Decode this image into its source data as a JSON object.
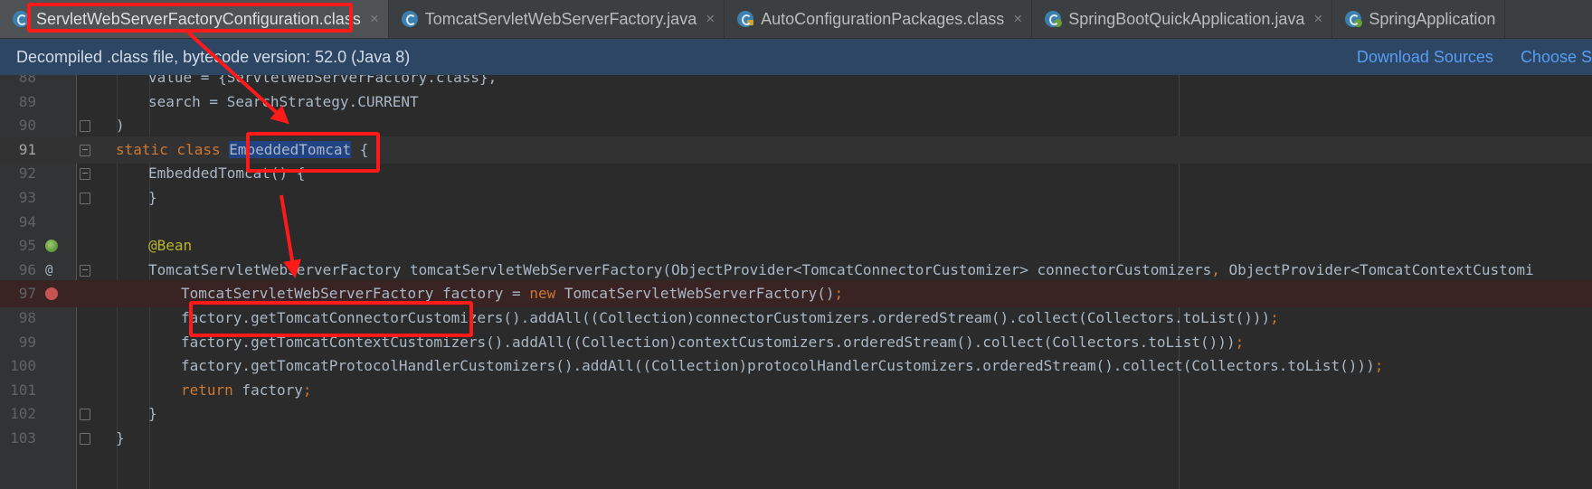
{
  "tabs": [
    {
      "label": "ServletWebServerFactoryConfiguration.class",
      "icon": "class-file-icon",
      "active": true
    },
    {
      "label": "TomcatServletWebServerFactory.java",
      "icon": "class-file-icon",
      "active": false
    },
    {
      "label": "AutoConfigurationPackages.class",
      "icon": "locked-class-file-icon",
      "active": false
    },
    {
      "label": "SpringBootQuickApplication.java",
      "icon": "spring-boot-class-icon",
      "active": false
    },
    {
      "label": "SpringApplication",
      "icon": "spring-boot-class-icon",
      "active": false
    }
  ],
  "tab_close_glyph": "×",
  "banner": {
    "message": "Decompiled .class file, bytecode version: 52.0 (Java 8)",
    "download_sources": "Download Sources",
    "choose_sources": "Choose S"
  },
  "code_lines": [
    {
      "n": "88",
      "indent": 2,
      "text": "value = {ServletWebServerFactory.class},"
    },
    {
      "n": "89",
      "indent": 2,
      "text": "search = SearchStrategy.CURRENT"
    },
    {
      "n": "90",
      "indent": 1,
      "text": ")"
    },
    {
      "n": "91",
      "indent": 1,
      "kw_before": "static class ",
      "selected": "EmbeddedTomcat",
      "text_after": " {"
    },
    {
      "n": "92",
      "indent": 2,
      "text": "EmbeddedTomcat() {"
    },
    {
      "n": "93",
      "indent": 2,
      "text": "}"
    },
    {
      "n": "94",
      "indent": 0,
      "text": ""
    },
    {
      "n": "95",
      "indent": 2,
      "annotation": "@Bean"
    },
    {
      "n": "96",
      "indent": 2,
      "text": "TomcatServletWebServerFactory tomcatServletWebServerFactory(ObjectProvider<TomcatConnectorCustomizer> connectorCustomizers",
      "kw_after": ", ",
      "text_tail": "ObjectProvider<TomcatContextCustomi"
    },
    {
      "n": "97",
      "indent": 3,
      "text": "TomcatServletWebServerFactory factory = ",
      "kw_after": "new",
      "text_tail": " TomcatServletWebServerFactory()",
      "kw_end": ";"
    },
    {
      "n": "98",
      "indent": 3,
      "text": "factory.getTomcatConnectorCustomizers().addAll((Collection)connectorCustomizers.orderedStream().collect(Collectors.toList()))",
      "kw_end": ";"
    },
    {
      "n": "99",
      "indent": 3,
      "text": "factory.getTomcatContextCustomizers().addAll((Collection)contextCustomizers.orderedStream().collect(Collectors.toList()))",
      "kw_end": ";"
    },
    {
      "n": "100",
      "indent": 3,
      "text": "factory.getTomcatProtocolHandlerCustomizers().addAll((Collection)protocolHandlerCustomizers.orderedStream().collect(Collectors.toList()))",
      "kw_end": ";"
    },
    {
      "n": "101",
      "indent": 3,
      "kw_before": "return",
      "text_after": " factory",
      "kw_end": ";"
    },
    {
      "n": "102",
      "indent": 2,
      "text": "}"
    },
    {
      "n": "103",
      "indent": 1,
      "text": "}"
    }
  ],
  "gutter_marks": {
    "95": "bean-icon",
    "96": "at-sign",
    "97": "breakpoint-icon"
  },
  "gutter_at_glyph": "@",
  "current_line": "91",
  "breakpoint_line": "97",
  "colors": {
    "keyword": "#cc7832",
    "annotation": "#bbb529",
    "text": "#a9b7c6",
    "breakpoint": "#c75450",
    "callout": "#ff1a1a"
  }
}
